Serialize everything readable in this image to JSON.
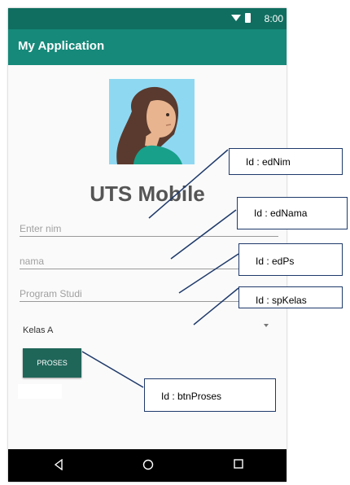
{
  "status_bar": {
    "time": "8:00",
    "wifi_icon": "wifi-icon",
    "battery_icon": "battery-icon"
  },
  "app_bar": {
    "title": "My Application"
  },
  "avatar": {
    "icon": "woman-avatar-illustration"
  },
  "headline": "UTS Mobile",
  "form": {
    "nim_placeholder": "Enter nim",
    "nama_placeholder": "nama",
    "ps_placeholder": "Program Studi",
    "kelas_value": "Kelas A",
    "proses_label": "PROSES"
  },
  "nav": {
    "back_icon": "back-icon",
    "home_icon": "home-icon",
    "recent_icon": "recent-apps-icon"
  },
  "callouts": {
    "edNim": "Id : edNim",
    "edNama": "Id : edNama",
    "edPs": "Id : edPs",
    "spKelas": "Id : spKelas",
    "btnProses": "Id : btnProses"
  },
  "colors": {
    "status_bar": "#0f6e60",
    "app_bar": "#16897a",
    "button": "#1f6659",
    "callout_line": "#1f3a6b"
  }
}
